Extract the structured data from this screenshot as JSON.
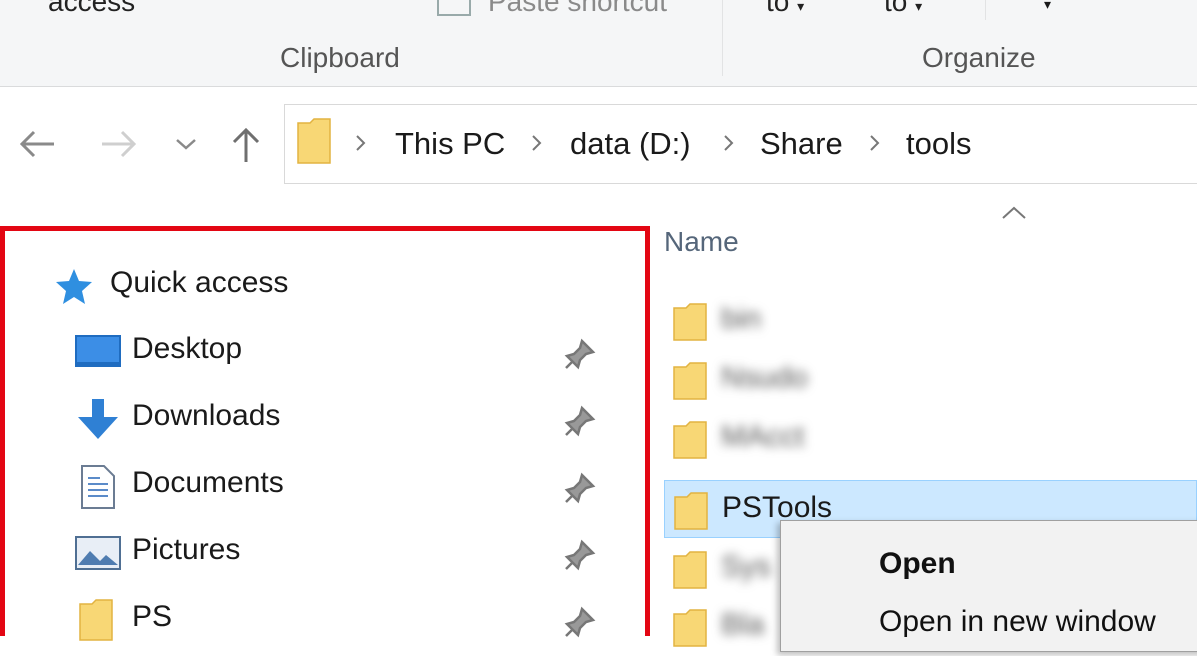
{
  "ribbon": {
    "access_text": "access",
    "paste_shortcut": "Paste shortcut",
    "move_to": "to",
    "copy_to": "to",
    "groups": {
      "clipboard": "Clipboard",
      "organize": "Organize"
    }
  },
  "address": {
    "crumbs": [
      "This PC",
      "data (D:)",
      "Share",
      "tools"
    ]
  },
  "nav": {
    "quick_access": "Quick access",
    "items": [
      {
        "label": "Desktop",
        "icon": "desktop-icon"
      },
      {
        "label": "Downloads",
        "icon": "downloads-icon"
      },
      {
        "label": "Documents",
        "icon": "documents-icon"
      },
      {
        "label": "Pictures",
        "icon": "pictures-icon"
      },
      {
        "label": "PS",
        "icon": "folder-icon"
      }
    ]
  },
  "files": {
    "column_name": "Name",
    "rows": [
      {
        "label": "bin",
        "blurred": true
      },
      {
        "label": "Nsudo",
        "blurred": true
      },
      {
        "label": "MAcct",
        "blurred": true
      },
      {
        "label": "PSTools",
        "blurred": false,
        "selected": true
      },
      {
        "label": "Sys",
        "blurred": true
      },
      {
        "label": "Bla",
        "blurred": true
      }
    ]
  },
  "context_menu": {
    "items": [
      "Open",
      "Open in new window"
    ]
  },
  "colors": {
    "highlight": "#e30613",
    "selection": "#cce8ff",
    "folder": "#f8d775"
  }
}
